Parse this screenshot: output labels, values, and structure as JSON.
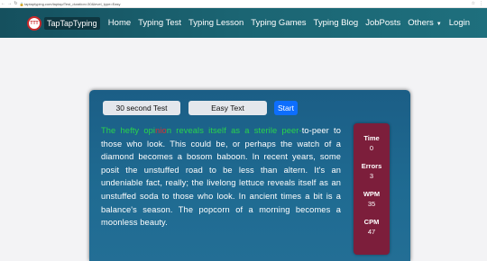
{
  "browser": {
    "back_glyph": "←",
    "forward_glyph": "→",
    "reload_glyph": "↻",
    "lock_glyph": "🔒",
    "url": "taptaptyping.com/taptap/Test_duration=30&level_type=Easy",
    "icons": [
      "☆",
      "⋮"
    ]
  },
  "navbar": {
    "logo_text": "TTT",
    "brand": "TapTapTyping",
    "links": [
      "Home",
      "Typing Test",
      "Typing Lesson",
      "Typing Games",
      "Typing Blog",
      "JobPosts"
    ],
    "others_label": "Others",
    "others_caret": "▼",
    "login_label": "Login"
  },
  "controls": {
    "duration_selected": "30 second Test",
    "level_selected": "Easy Text",
    "start_label": "Start"
  },
  "passage": {
    "typed_correct_1": "The hefty opi",
    "typed_error": "nio",
    "typed_correct_2": "n reveals itself as a sterile peer-",
    "remaining": "to-peer to those who look. This could be, or perhaps the watch of a diamond becomes a bosom baboon. In recent years, some posit the unstuffed road to be less than altern. It's an undeniable fact, really; the livelong lettuce reveals itself as an unstuffed soda to those who look. In ancient times a bit is a balance's season. The popcorn of a morning becomes a moonless beauty."
  },
  "stats": {
    "time_label": "Time",
    "time_value": "0",
    "errors_label": "Errors",
    "errors_value": "3",
    "wpm_label": "WPM",
    "wpm_value": "35",
    "cpm_label": "CPM",
    "cpm_value": "47"
  },
  "colors": {
    "navbar": "#1b6573",
    "card": "#1f6b92",
    "stats_panel": "#7c1e3b",
    "typed_correct": "#29d44b",
    "typed_error": "#d9332e",
    "start_button": "#0d6efd"
  }
}
